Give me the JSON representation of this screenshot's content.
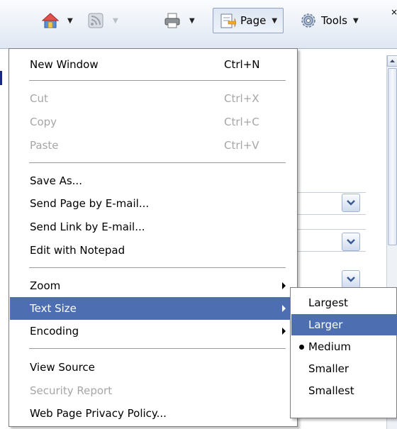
{
  "toolbar": {
    "page_label": "Page",
    "tools_label": "Tools",
    "close_glyph": "×",
    "icons": [
      "home-icon",
      "feeds-icon",
      "print-icon",
      "page-icon",
      "tools-gear-icon"
    ]
  },
  "menu": {
    "new_window": {
      "label": "New Window",
      "shortcut": "Ctrl+N"
    },
    "cut": {
      "label": "Cut",
      "shortcut": "Ctrl+X"
    },
    "copy": {
      "label": "Copy",
      "shortcut": "Ctrl+C"
    },
    "paste": {
      "label": "Paste",
      "shortcut": "Ctrl+V"
    },
    "save_as": {
      "label": "Save As..."
    },
    "send_page": {
      "label": "Send Page by E-mail..."
    },
    "send_link": {
      "label": "Send Link by E-mail..."
    },
    "edit_notepad": {
      "label": "Edit with Notepad"
    },
    "zoom": {
      "label": "Zoom"
    },
    "text_size": {
      "label": "Text Size"
    },
    "encoding": {
      "label": "Encoding"
    },
    "view_source": {
      "label": "View Source"
    },
    "security_report": {
      "label": "Security Report"
    },
    "privacy_policy": {
      "label": "Web Page Privacy Policy..."
    }
  },
  "text_size_submenu": {
    "largest": "Largest",
    "larger": "Larger",
    "medium": "Medium",
    "smaller": "Smaller",
    "smallest": "Smallest",
    "selected": "Medium",
    "highlighted": "Larger"
  },
  "colors": {
    "highlight": "#4d6fb1",
    "disabled_text": "#a6a6a6",
    "toolbar_top": "#fbfcfe",
    "toolbar_bottom": "#dfe7f3"
  }
}
